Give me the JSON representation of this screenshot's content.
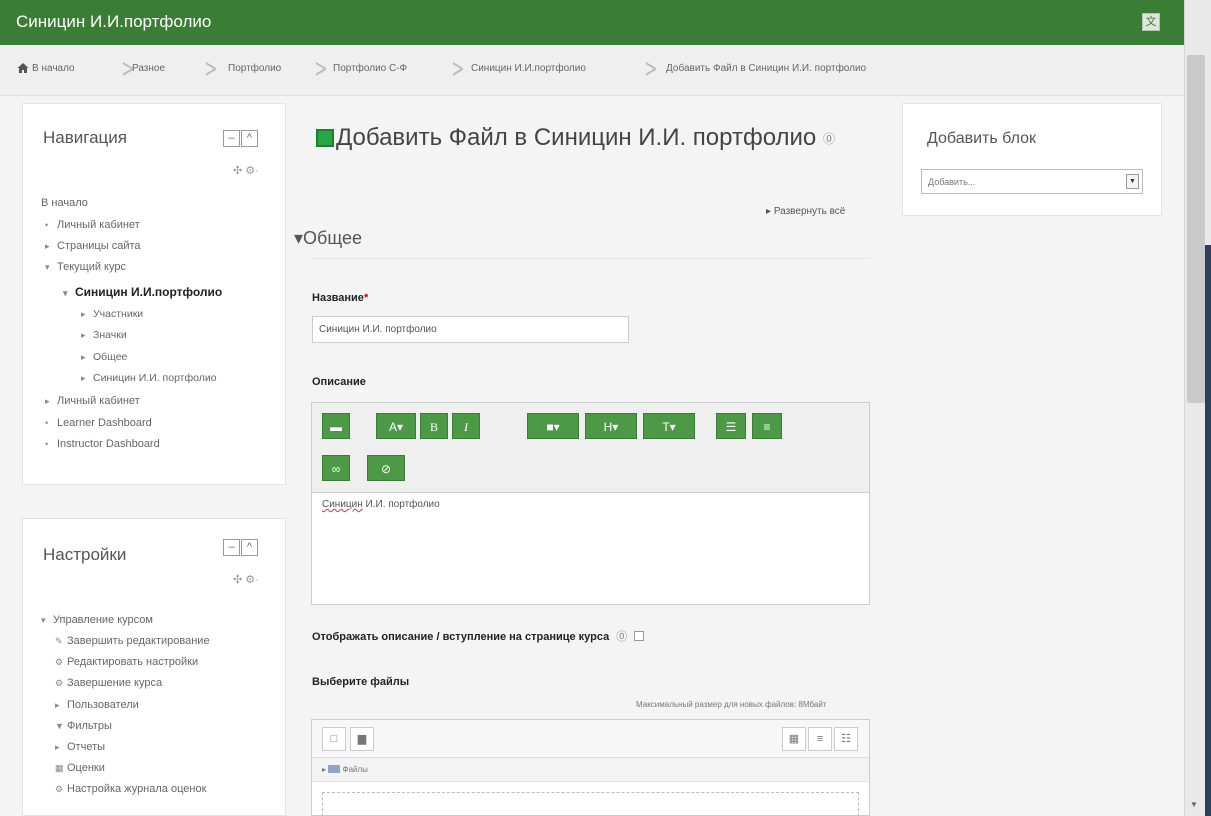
{
  "header": {
    "site_title": "Синицин И.И.портфолио",
    "lang_icon": "translate-icon"
  },
  "breadcrumb": {
    "items": [
      "В начало",
      "Разное",
      "Портфолио",
      "Портфолио С-Ф",
      "Синицин И.И.портфолио",
      "Добавить Файл в Синицин И.И. портфолио"
    ]
  },
  "navigation": {
    "title": "Навигация",
    "items": [
      {
        "label": "В начало",
        "icon": "",
        "level": 0
      },
      {
        "label": "Личный кабинет",
        "icon": "•",
        "level": 0
      },
      {
        "label": "Страницы сайта",
        "icon": "▸",
        "level": 0
      },
      {
        "label": "Текущий курс",
        "icon": "▾",
        "level": 0
      },
      {
        "label": "Синицин И.И.портфолио",
        "icon": "▾",
        "level": 1
      },
      {
        "label": "Участники",
        "icon": "▸",
        "level": 2
      },
      {
        "label": "Значки",
        "icon": "▸",
        "level": 2
      },
      {
        "label": "Общее",
        "icon": "▸",
        "level": 2
      },
      {
        "label": "Синицин И.И. портфолио",
        "icon": "▸",
        "level": 2
      },
      {
        "label": "Личный кабинет",
        "icon": "▸",
        "level": 0
      },
      {
        "label": "Learner Dashboard",
        "icon": "•",
        "level": 0
      },
      {
        "label": "Instructor Dashboard",
        "icon": "•",
        "level": 0
      }
    ]
  },
  "settings": {
    "title": "Настройки",
    "items": [
      {
        "label": "Управление курсом",
        "icon": "▾",
        "level": 0
      },
      {
        "label": "Завершить редактирование",
        "icon": "✎",
        "level": 1
      },
      {
        "label": "Редактировать настройки",
        "icon": "⚙",
        "level": 1
      },
      {
        "label": "Завершение курса",
        "icon": "⚙",
        "level": 1
      },
      {
        "label": "Пользователи",
        "icon": "▸",
        "level": 1
      },
      {
        "label": "Фильтры",
        "icon": "▼",
        "level": 1
      },
      {
        "label": "Отчеты",
        "icon": "▸",
        "level": 1
      },
      {
        "label": "Оценки",
        "icon": "▦",
        "level": 1
      },
      {
        "label": "Настройка журнала оценок",
        "icon": "⚙",
        "level": 1
      }
    ]
  },
  "main": {
    "title": "Добавить Файл в Синицин И.И. портфолио",
    "expand_all": "Развернуть всё",
    "section_general": "Общее",
    "name_label": "Название",
    "name_required": "*",
    "name_value": "Синицин И.И. портфолио",
    "description_label": "Описание",
    "description_text_misspelled": "Синицин",
    "description_text_rest": " И.И. портфолио",
    "show_description_label": "Отображать описание / вступление на странице курса",
    "select_files_label": "Выберите файлы",
    "max_size": "Максимальный размер для новых файлов: 8Мбайт",
    "files_folder": "Файлы"
  },
  "add_block": {
    "title": "Добавить блок",
    "select_value": "Добавить..."
  },
  "colors": {
    "brand": "#3a7d34",
    "toolbar_button": "#4c9a45"
  }
}
